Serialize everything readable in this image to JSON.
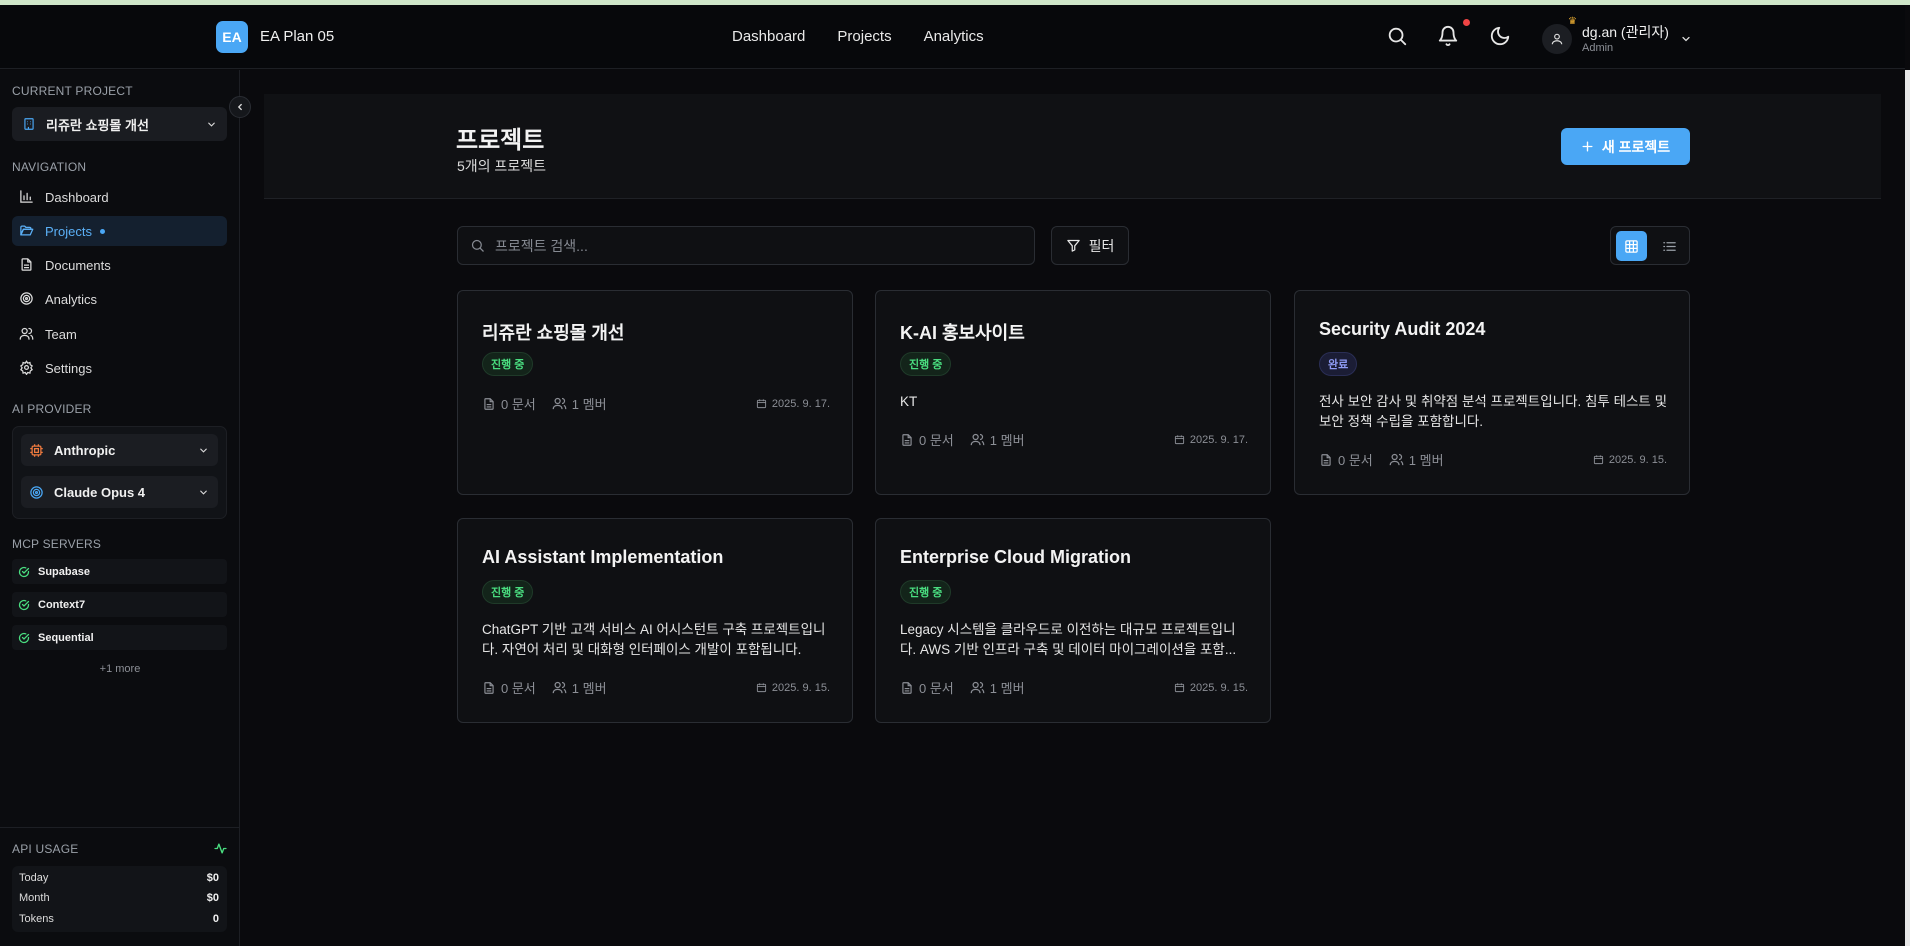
{
  "header": {
    "logo_text": "EA",
    "app_title": "EA Plan 05",
    "nav": [
      "Dashboard",
      "Projects",
      "Analytics"
    ],
    "user": {
      "name": "dg.an (관리자)",
      "role": "Admin"
    }
  },
  "sidebar": {
    "current_project_label": "CURRENT PROJECT",
    "current_project": "리쥬란 쇼핑몰 개선",
    "navigation_label": "NAVIGATION",
    "nav_items": [
      {
        "label": "Dashboard",
        "icon": "bar-chart-icon"
      },
      {
        "label": "Projects",
        "icon": "folder-open-icon",
        "active": true
      },
      {
        "label": "Documents",
        "icon": "file-text-icon"
      },
      {
        "label": "Analytics",
        "icon": "target-icon"
      },
      {
        "label": "Team",
        "icon": "users-icon"
      },
      {
        "label": "Settings",
        "icon": "gear-icon"
      }
    ],
    "ai_provider_label": "AI PROVIDER",
    "ai_provider": "Anthropic",
    "ai_model": "Claude Opus 4",
    "mcp_label": "MCP SERVERS",
    "mcp_servers": [
      "Supabase",
      "Context7",
      "Sequential"
    ],
    "mcp_more": "+1 more",
    "api_usage_label": "API USAGE",
    "usage": [
      {
        "label": "Today",
        "value": "$0"
      },
      {
        "label": "Month",
        "value": "$0"
      },
      {
        "label": "Tokens",
        "value": "0"
      }
    ]
  },
  "main": {
    "title": "프로젝트",
    "subtitle": "5개의 프로젝트",
    "new_button": "새 프로젝트",
    "search_placeholder": "프로젝트 검색...",
    "filter_label": "필터",
    "projects": [
      {
        "title": "리쥬란 쇼핑몰 개선",
        "status": "진행 중",
        "status_kind": "progress",
        "desc": "",
        "docs": "0 문서",
        "members": "1 멤버",
        "date": "2025. 9. 17."
      },
      {
        "title": "K-AI 홍보사이트",
        "status": "진행 중",
        "status_kind": "progress",
        "desc": "KT",
        "docs": "0 문서",
        "members": "1 멤버",
        "date": "2025. 9. 17."
      },
      {
        "title": "Security Audit 2024",
        "status": "완료",
        "status_kind": "done",
        "desc": "전사 보안 감사 및 취약점 분석 프로젝트입니다. 침투 테스트 및 보안 정책 수립을 포함합니다.",
        "docs": "0 문서",
        "members": "1 멤버",
        "date": "2025. 9. 15."
      },
      {
        "title": "AI Assistant Implementation",
        "status": "진행 중",
        "status_kind": "progress",
        "desc": "ChatGPT 기반 고객 서비스 AI 어시스턴트 구축 프로젝트입니다. 자연어 처리 및 대화형 인터페이스 개발이 포함됩니다.",
        "docs": "0 문서",
        "members": "1 멤버",
        "date": "2025. 9. 15."
      },
      {
        "title": "Enterprise Cloud Migration",
        "status": "진행 중",
        "status_kind": "progress",
        "desc": "Legacy 시스템을 클라우드로 이전하는 대규모 프로젝트입니다. AWS 기반 인프라 구축 및 데이터 마이그레이션을 포함...",
        "docs": "0 문서",
        "members": "1 멤버",
        "date": "2025. 9. 15."
      }
    ]
  },
  "colors": {
    "accent": "#4aa7f5",
    "progress": "#4ade80",
    "done": "#8f9cf5",
    "alert": "#ef4444"
  }
}
